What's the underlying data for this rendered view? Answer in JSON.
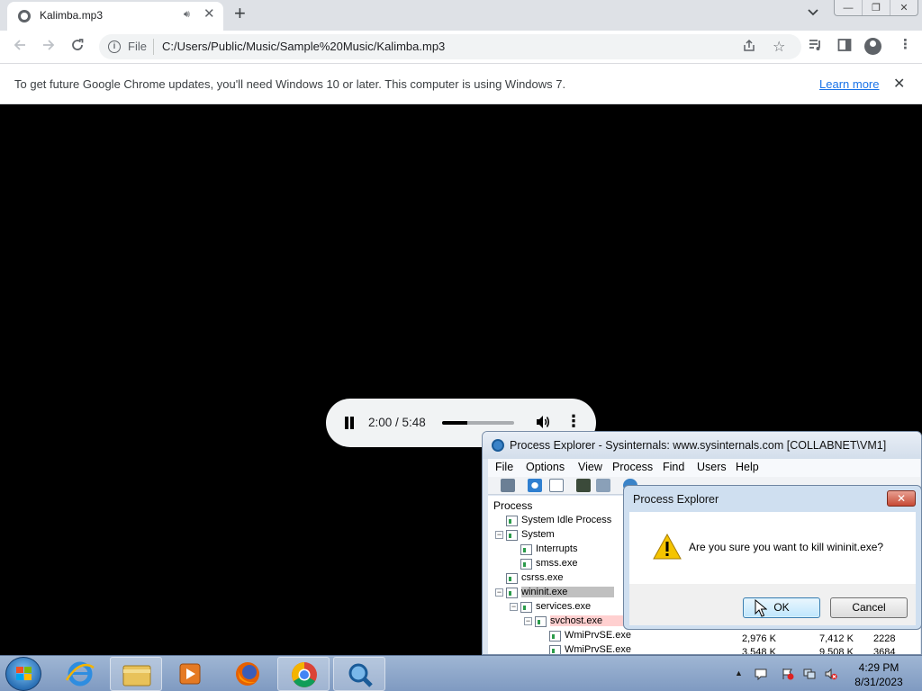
{
  "browser": {
    "tab": {
      "title": "Kalimba.mp3",
      "audio_icon": "speaker-icon",
      "close_symbol": "✕"
    },
    "new_tab_symbol": "+",
    "tab_search_symbol": "⌄",
    "window_buttons": [
      "—",
      "❐",
      "✕"
    ],
    "omnibox": {
      "scheme_label": "File",
      "url": "C:/Users/Public/Music/Sample%20Music/Kalimba.mp3"
    },
    "infobar": {
      "message": "To get future Google Chrome updates, you'll need Windows 10 or later. This computer is using Windows 7.",
      "link_label": "Learn more",
      "close_symbol": "✕"
    }
  },
  "player": {
    "state": "playing",
    "time_text": "2:00 / 5:48",
    "progress_fraction": 0.345
  },
  "process_explorer": {
    "title": "Process Explorer - Sysinternals: www.sysinternals.com [COLLABNET\\VM1]",
    "menu": [
      "File",
      "Options",
      "View",
      "Process",
      "Find",
      "Users",
      "Help"
    ],
    "column_header": "Process",
    "processes": [
      {
        "name": "System Idle Process",
        "level": 0,
        "toggle": ""
      },
      {
        "name": "System",
        "level": 0,
        "toggle": "−"
      },
      {
        "name": "Interrupts",
        "level": 1,
        "toggle": ""
      },
      {
        "name": "smss.exe",
        "level": 1,
        "toggle": ""
      },
      {
        "name": "csrss.exe",
        "level": 0,
        "toggle": ""
      },
      {
        "name": "wininit.exe",
        "level": 0,
        "toggle": "−",
        "highlight": "selected"
      },
      {
        "name": "services.exe",
        "level": 1,
        "toggle": "−"
      },
      {
        "name": "svchost.exe",
        "level": 2,
        "toggle": "−",
        "highlight": "service"
      },
      {
        "name": "WmiPrvSE.exe",
        "level": 3,
        "toggle": ""
      },
      {
        "name": "WmiPrvSE.exe",
        "level": 3,
        "toggle": ""
      }
    ],
    "visible_values": [
      {
        "private_bytes": "2,976 K",
        "working_set": "7,412 K",
        "pid": "2228"
      },
      {
        "private_bytes": "3,548 K",
        "working_set": "9,508 K",
        "pid": "3684"
      }
    ]
  },
  "dialog": {
    "title": "Process Explorer",
    "close_symbol": "✕",
    "message": "Are you sure you want to kill wininit.exe?",
    "ok_label": "OK",
    "cancel_label": "Cancel"
  },
  "taskbar": {
    "pinned": [
      "internet-explorer-icon",
      "file-explorer-icon",
      "media-player-icon",
      "firefox-icon",
      "chrome-icon",
      "process-explorer-icon"
    ],
    "clock": {
      "time": "4:29 PM",
      "date": "8/31/2023"
    }
  },
  "colors": {
    "selected_row": "#c0c0c0",
    "service_row": "#ffd0d0",
    "link": "#1a73e8"
  }
}
